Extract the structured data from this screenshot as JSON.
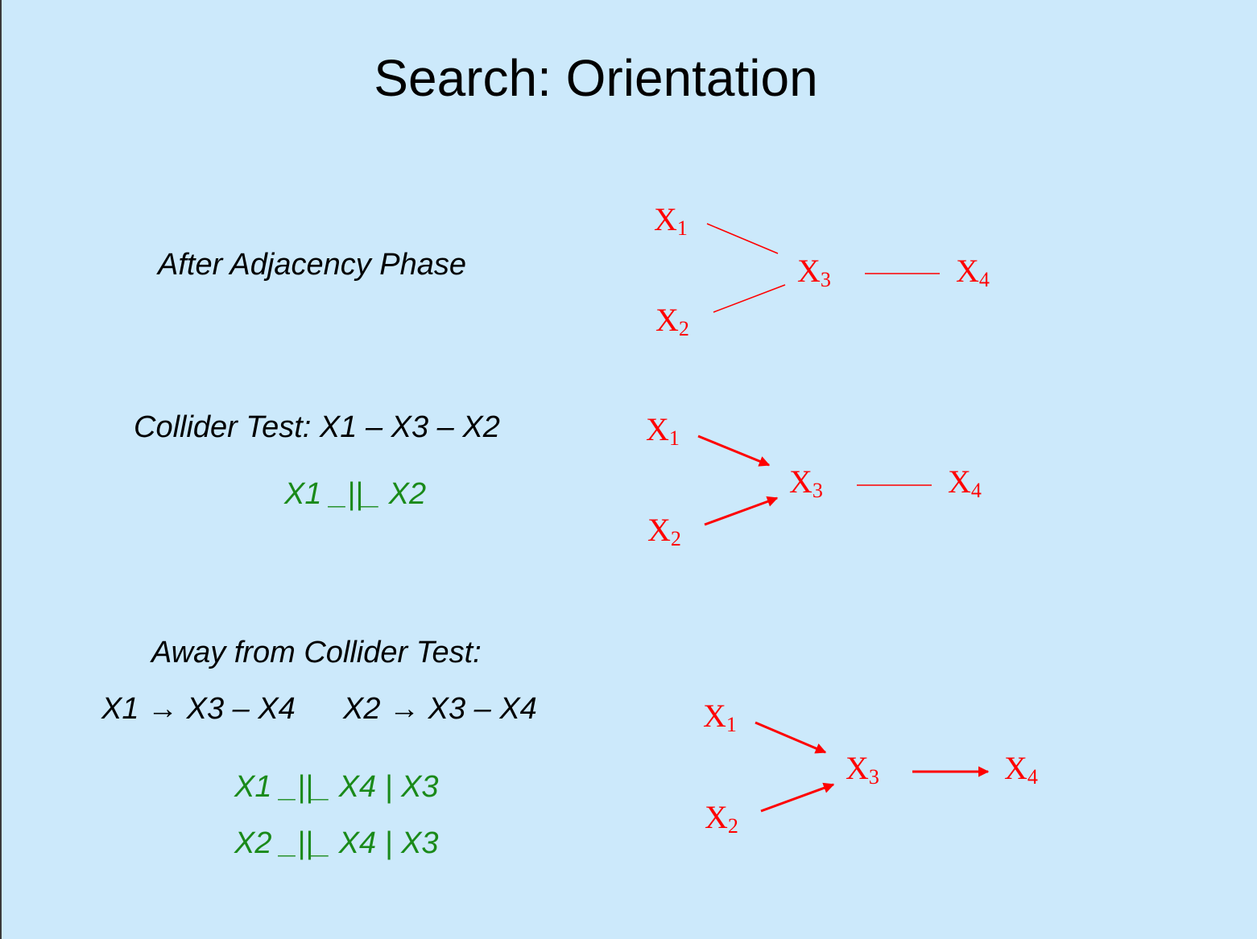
{
  "slide": {
    "title": "Search: Orientation"
  },
  "row1": {
    "label": "After Adjacency Phase",
    "nodes": [
      {
        "id": "X1",
        "name": "X",
        "sub": "1"
      },
      {
        "id": "X2",
        "name": "X",
        "sub": "2"
      },
      {
        "id": "X3",
        "name": "X",
        "sub": "3"
      },
      {
        "id": "X4",
        "name": "X",
        "sub": "4"
      }
    ],
    "edges": [
      {
        "from": "X1",
        "to": "X3",
        "type": "undirected"
      },
      {
        "from": "X2",
        "to": "X3",
        "type": "undirected"
      },
      {
        "from": "X3",
        "to": "X4",
        "type": "undirected"
      }
    ]
  },
  "row2": {
    "label": "Collider Test: X1 – X3 – X2",
    "independence": "X1 _||_ X2",
    "nodes": [
      {
        "id": "X1",
        "name": "X",
        "sub": "1"
      },
      {
        "id": "X2",
        "name": "X",
        "sub": "2"
      },
      {
        "id": "X3",
        "name": "X",
        "sub": "3"
      },
      {
        "id": "X4",
        "name": "X",
        "sub": "4"
      }
    ],
    "edges": [
      {
        "from": "X1",
        "to": "X3",
        "type": "directed"
      },
      {
        "from": "X2",
        "to": "X3",
        "type": "directed"
      },
      {
        "from": "X3",
        "to": "X4",
        "type": "undirected"
      }
    ]
  },
  "row3": {
    "label": "Away from Collider Test:",
    "rule_a": "X1 → X3 – X4",
    "rule_b": "X2 → X3 – X4",
    "independence_1": "X1 _||_ X4 | X3",
    "independence_2": "X2 _||_ X4 | X3",
    "nodes": [
      {
        "id": "X1",
        "name": "X",
        "sub": "1"
      },
      {
        "id": "X2",
        "name": "X",
        "sub": "2"
      },
      {
        "id": "X3",
        "name": "X",
        "sub": "3"
      },
      {
        "id": "X4",
        "name": "X",
        "sub": "4"
      }
    ],
    "edges": [
      {
        "from": "X1",
        "to": "X3",
        "type": "directed"
      },
      {
        "from": "X2",
        "to": "X3",
        "type": "directed"
      },
      {
        "from": "X3",
        "to": "X4",
        "type": "directed"
      }
    ]
  },
  "colors": {
    "background": "#cce9fb",
    "graph": "#ff0000",
    "independence_text": "#1a8a1a"
  }
}
